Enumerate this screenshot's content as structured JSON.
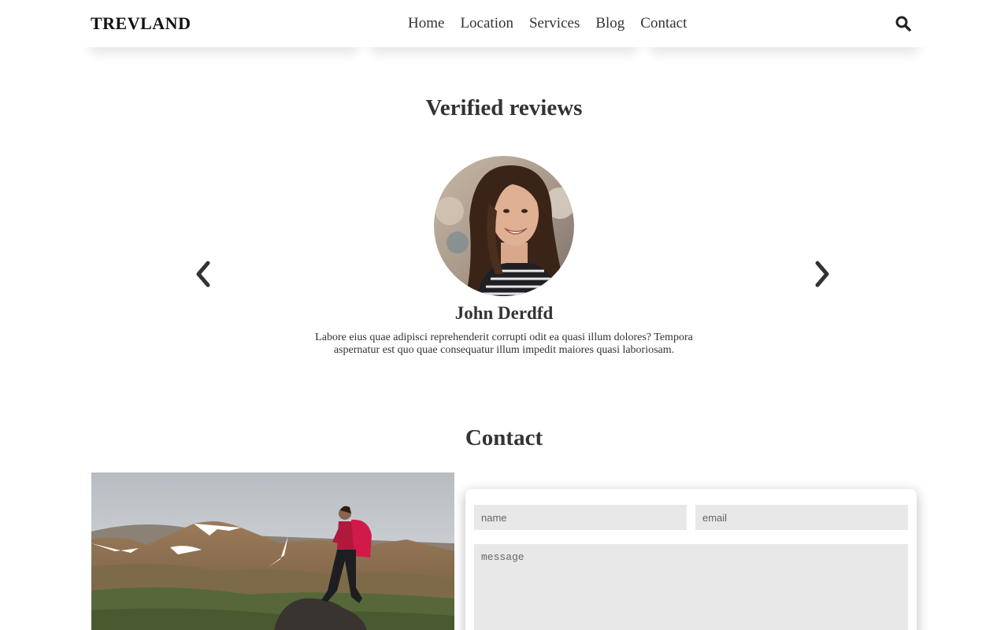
{
  "nav": {
    "logo": "TREVLAND",
    "links": [
      "Home",
      "Location",
      "Services",
      "Blog",
      "Contact"
    ]
  },
  "reviews": {
    "title": "Verified reviews",
    "reviewer_name": "John Derdfd",
    "review_text": "Labore eius quae adipisci reprehenderit corrupti odit ea quasi illum dolores? Tempora aspernatur est quo quae consequatur illum impedit maiores quasi laboriosam."
  },
  "contact": {
    "title": "Contact",
    "name_placeholder": "name",
    "email_placeholder": "email",
    "message_placeholder": "message"
  },
  "icons": {
    "search": "search-icon",
    "prev": "chevron-left-icon",
    "next": "chevron-right-icon"
  },
  "colors": {
    "text": "#333333",
    "field_bg": "#e8e8e8",
    "background": "#ffffff"
  }
}
